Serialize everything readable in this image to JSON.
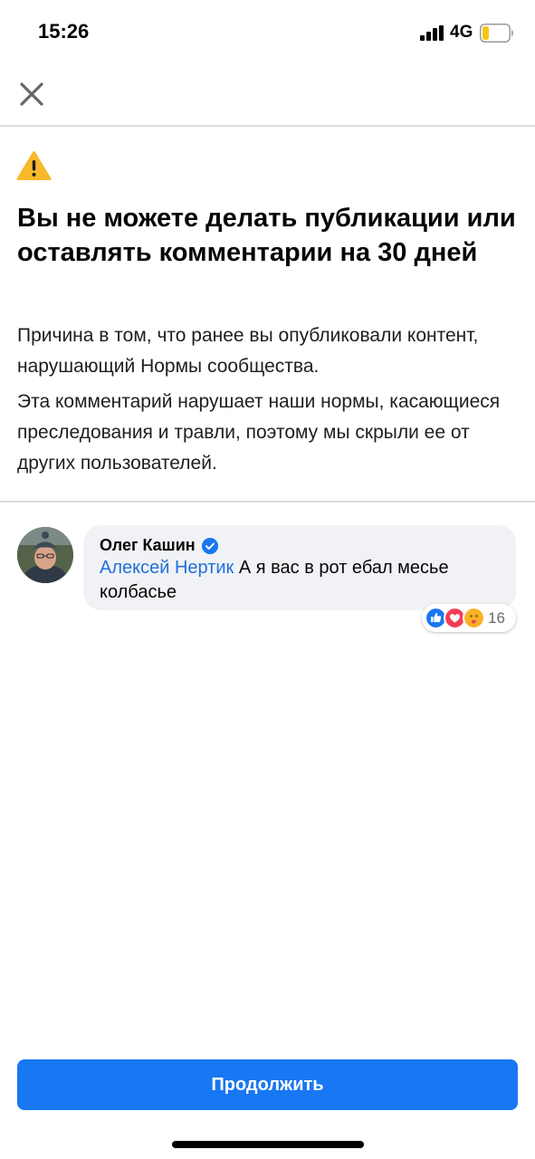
{
  "status_bar": {
    "time": "15:26",
    "network": "4G",
    "battery_level": 0.25,
    "battery_color": "#f5c518"
  },
  "header": {
    "close_icon": "close-icon"
  },
  "notice": {
    "icon": "warning-icon",
    "icon_color": "#f7b928",
    "title": "Вы не можете делать публикации или оставлять комментарии на 30 дней",
    "reason": "Причина в том, что ранее вы опубликовали контент, нарушающий Нормы сообщества.",
    "detail": "Эта комментарий нарушает наши нормы, касающиеся преследования и травли, поэтому мы скрыли ее от других пользователей."
  },
  "comment": {
    "author": "Олег Кашин",
    "verified": true,
    "mention": "Алексей Нертик",
    "text": "А я вас в рот ебал месье колбасье",
    "reactions": [
      "like",
      "love",
      "care"
    ],
    "reaction_count": "16"
  },
  "footer": {
    "continue_label": "Продолжить",
    "accent": "#1877f2"
  }
}
